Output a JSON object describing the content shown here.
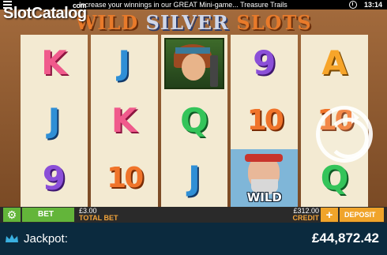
{
  "status_bar": {
    "message": "Increase your winnings in our GREAT Mini-game... Treasure Trails",
    "time": "13:14"
  },
  "watermark": {
    "text": "SlotCatalog",
    "sub": "com"
  },
  "game": {
    "title_part1": "WILD",
    "title_part2": "SILVER",
    "title_part3": "SLOTS",
    "reels": [
      [
        "K",
        "J",
        "9"
      ],
      [
        "J",
        "K",
        "10"
      ],
      [
        "",
        "Q",
        "J"
      ],
      [
        "9",
        "10",
        ""
      ],
      [
        "A",
        "10",
        "Q"
      ]
    ],
    "wild_label": "WILD"
  },
  "bottom_bar": {
    "bet_label": "BET",
    "total_bet_value": "£3.00",
    "total_bet_label": "TOTAL BET",
    "credit_value": "£312.00",
    "credit_label": "CREDIT",
    "plus_label": "+",
    "deposit_label": "DEPOSIT"
  },
  "jackpot": {
    "label": "Jackpot:",
    "amount": "£44,872.42"
  },
  "colors": {
    "accent_green": "#63b53a",
    "accent_orange": "#f0a42a",
    "jackpot_bg": "#0b2a3e"
  }
}
